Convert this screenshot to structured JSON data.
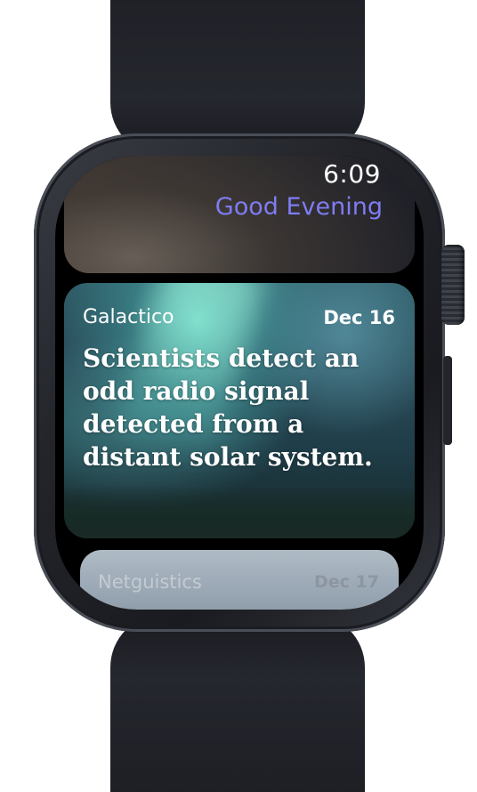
{
  "watch": {
    "time": "6:09",
    "greeting": "Good Evening"
  },
  "article": {
    "source": "Galactico",
    "date": "Dec 16",
    "headline": "Scientists detect an odd radio signal detected from a distant solar system."
  },
  "next_article": {
    "source": "Netguistics",
    "date": "Dec 17"
  },
  "colors": {
    "greeting_accent": "#7f7cf2",
    "band": "#23252b"
  }
}
